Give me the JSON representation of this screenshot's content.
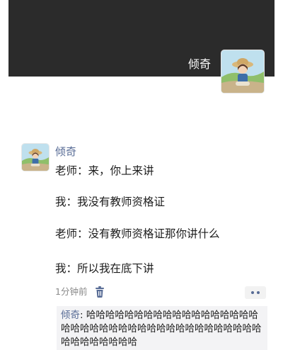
{
  "cover": {
    "user_name": "倾奇"
  },
  "post": {
    "author": "倾奇",
    "lines": [
      "老师：来，你上来讲",
      "我：我没有教师资格证",
      "老师：没有教师资格证那你讲什么",
      "我：所以我在底下讲"
    ],
    "time": "1分钟前"
  },
  "comment": {
    "author": "倾奇",
    "separator": ": ",
    "text": "哈哈哈哈哈哈哈哈哈哈哈哈哈哈哈哈哈哈哈哈哈哈哈哈哈哈哈哈哈哈哈哈哈哈哈哈哈哈哈哈哈哈哈哈哈哈哈"
  },
  "icons": {
    "delete": "trash-icon",
    "more": "more-dots-icon"
  },
  "colors": {
    "name_link": "#576b95",
    "cover_bg": "#2b2b2b",
    "comment_bg": "#f3f3f5"
  }
}
